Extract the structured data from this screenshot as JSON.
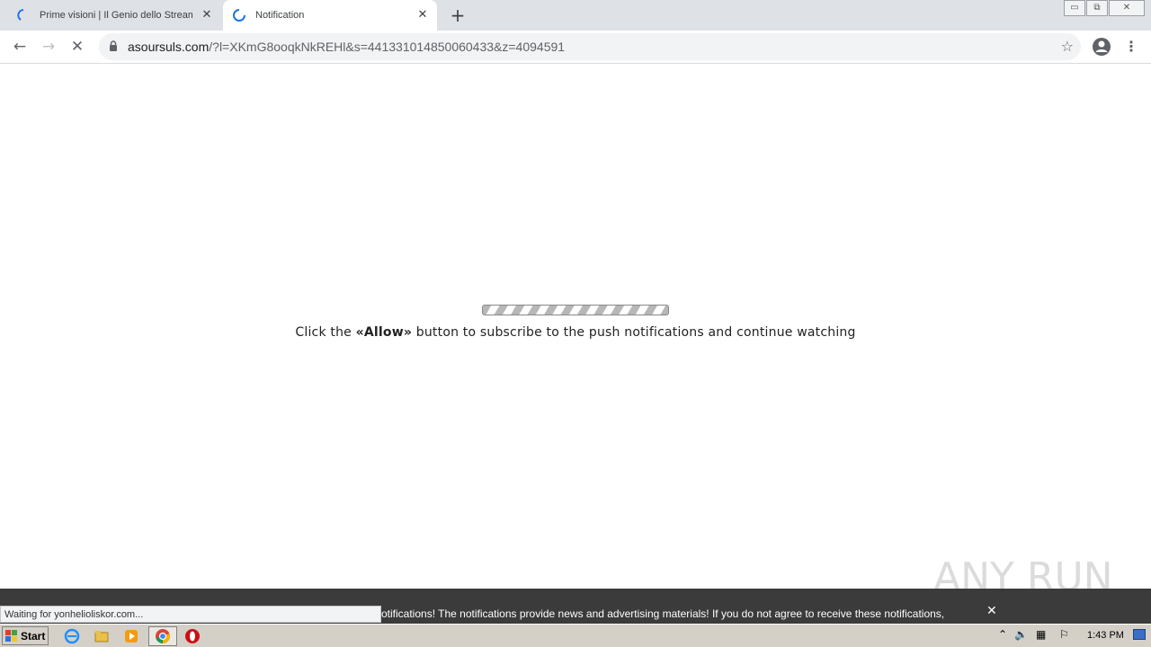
{
  "browser": {
    "tabs": [
      {
        "title": "Prime visioni | Il Genio dello Streaming",
        "active": false
      },
      {
        "title": "Notification",
        "active": true
      }
    ],
    "window_controls": {
      "minimize": "▭",
      "restore": "⧉",
      "close": "✕"
    },
    "url_host": "asoursuls.com",
    "url_rest": "/?l=XKmG8ooqkNkREHl&s=441331014850060433&z=4094591",
    "status_text": "Waiting for yonhelioliskor.com..."
  },
  "page": {
    "message_before": "Click the ",
    "message_bold": "«Allow»",
    "message_after": " button to subscribe to the push notifications and continue watching"
  },
  "banner": {
    "text": "otifications! The notifications provide news and advertising materials! If you do not agree to receive these notifications,",
    "close_label": "✕"
  },
  "watermark": {
    "text": "ANY RUN"
  },
  "taskbar": {
    "start_label": "Start",
    "clock": "1:43 PM",
    "icons": [
      "ie-icon",
      "explorer-icon",
      "media-player-icon",
      "chrome-icon",
      "opera-icon"
    ]
  },
  "colors": {
    "tabstrip": "#dee1e6",
    "banner": "#3b3b3b",
    "taskbar": "#d4d0c8",
    "chrome_blue": "#1a73e8"
  }
}
